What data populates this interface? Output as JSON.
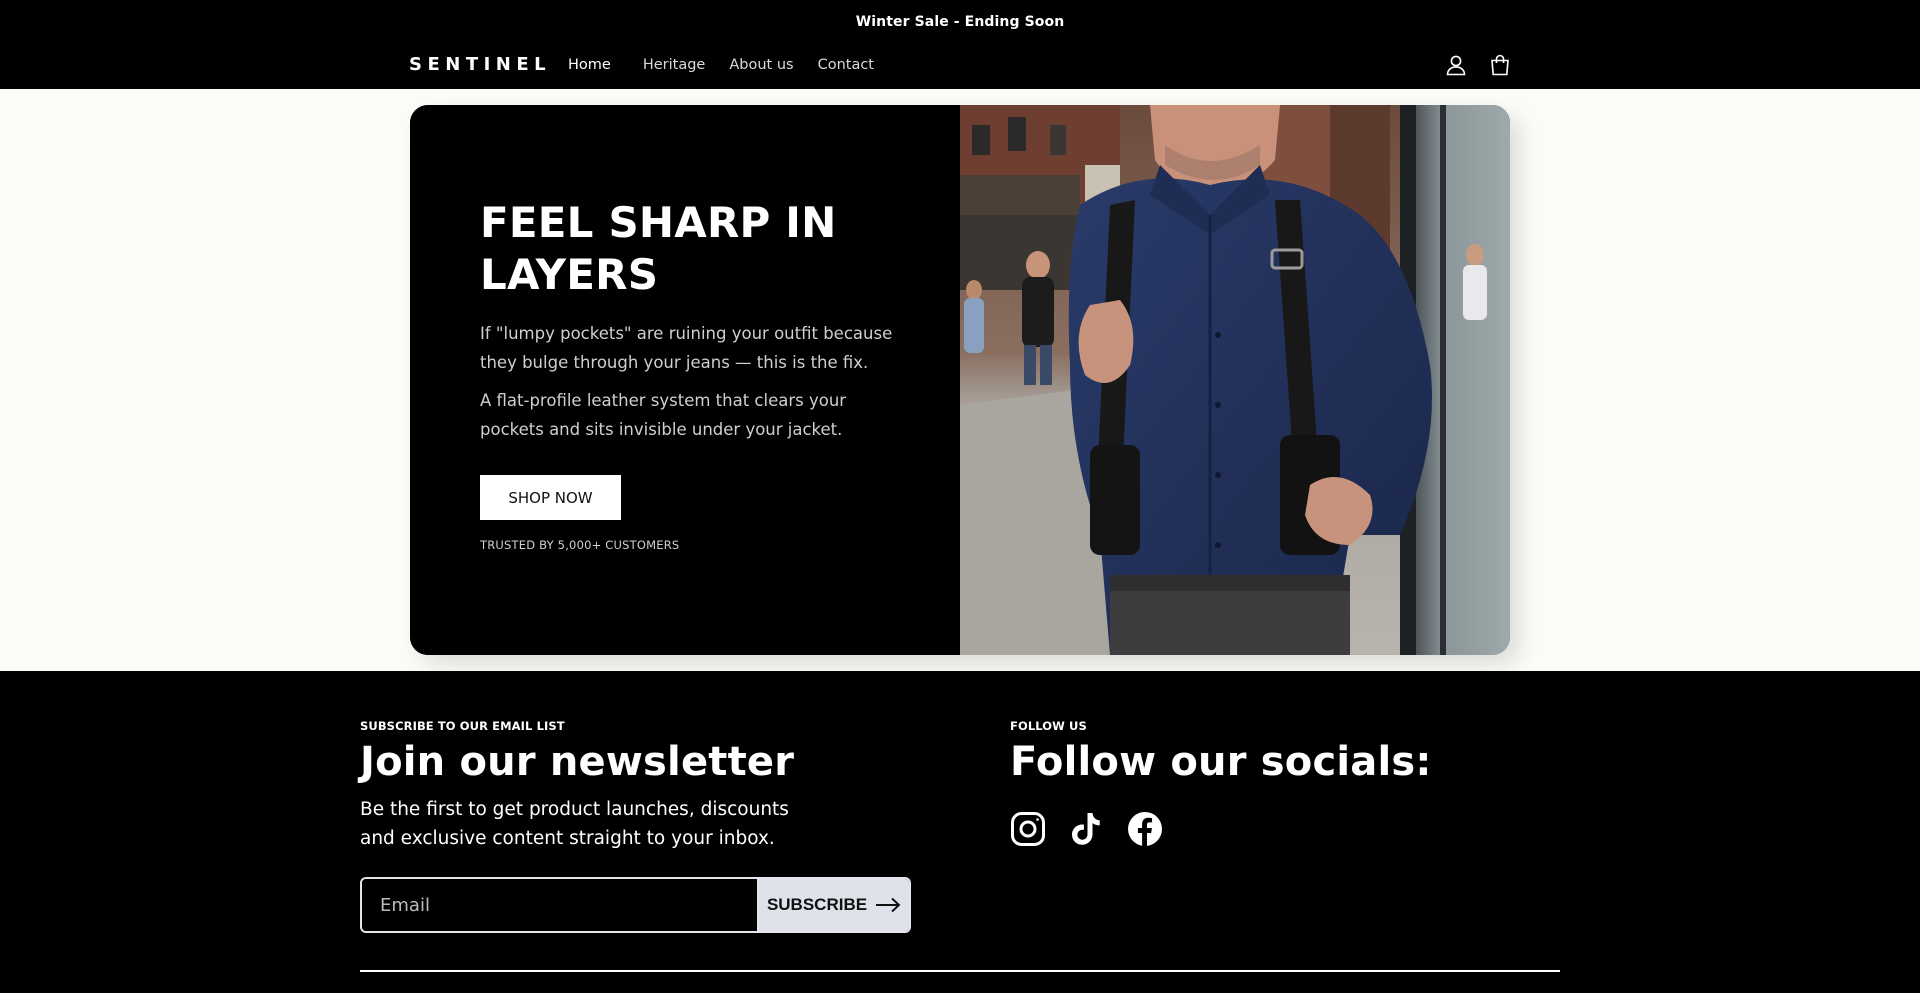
{
  "announcement": {
    "text": "Winter Sale - Ending Soon"
  },
  "header": {
    "logo": "SENTINEL",
    "nav": [
      {
        "label": "Home",
        "active": true
      },
      {
        "label": "Heritage",
        "active": false
      },
      {
        "label": "About us",
        "active": false
      },
      {
        "label": "Contact",
        "active": false
      }
    ],
    "icons": [
      "account-icon",
      "cart-icon"
    ]
  },
  "hero": {
    "title": "FEEL SHARP IN LAYERS",
    "paragraph_1": "If \"lumpy pockets\" are ruining your outfit because they bulge through your jeans — this is the fix.",
    "paragraph_2": "A flat-profile leather system that clears your pockets and sits invisible under your jacket.",
    "cta_label": "SHOP NOW",
    "trust_text": "TRUSTED BY 5,000+ CUSTOMERS",
    "image_alt": "man-wearing-leather-shoulder-holster-photo"
  },
  "footer": {
    "newsletter": {
      "eyebrow": "SUBSCRIBE TO OUR EMAIL LIST",
      "title": "Join our newsletter",
      "description": "Be the first to get product launches, discounts and exclusive content straight to your inbox.",
      "email_placeholder": "Email",
      "subscribe_label": "SUBSCRIBE"
    },
    "social": {
      "eyebrow": "FOLLOW US",
      "title": "Follow our socials:",
      "icons": [
        "instagram-icon",
        "tiktok-icon",
        "facebook-icon"
      ]
    }
  },
  "colors": {
    "background": "#fbfbf7",
    "dark": "#000000",
    "button_light": "#ffffff",
    "subscribe_button": "#dfe2ea",
    "shirt_blue": "#22325c"
  }
}
